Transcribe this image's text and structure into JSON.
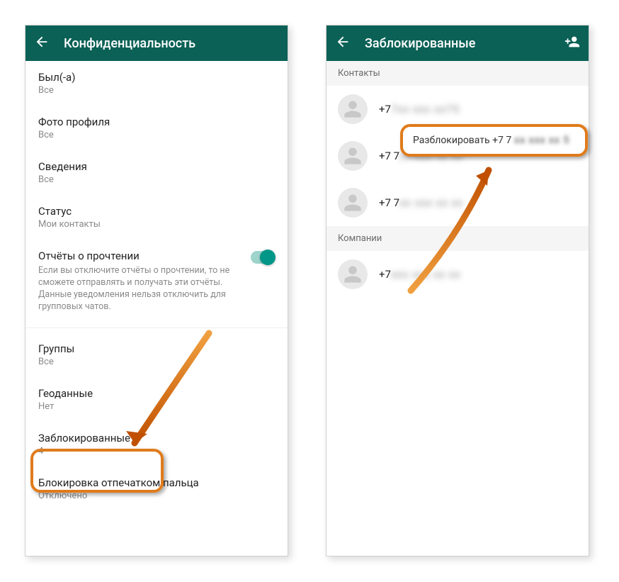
{
  "left": {
    "title": "Конфиденциальность",
    "items": {
      "lastseen": {
        "label": "Был(-а)",
        "sub": "Все"
      },
      "photo": {
        "label": "Фото профиля",
        "sub": "Все"
      },
      "about": {
        "label": "Сведения",
        "sub": "Все"
      },
      "status": {
        "label": "Статус",
        "sub": "Мои контакты"
      },
      "readreceipts": {
        "label": "Отчёты о прочтении",
        "desc": "Если вы отключите отчёты о прочтении, то не сможете отправлять и получать эти отчёты. Данные уведомления нельзя отключить для групповых чатов."
      },
      "groups": {
        "label": "Группы",
        "sub": "Все"
      },
      "location": {
        "label": "Геоданные",
        "sub": "Нет"
      },
      "blocked": {
        "label": "Заблокированные",
        "sub": "4"
      },
      "fingerprint": {
        "label": "Блокировка отпечатком пальца",
        "sub": "Отключено"
      }
    }
  },
  "right": {
    "title": "Заблокированные",
    "section_contacts": "Контакты",
    "section_companies": "Компании",
    "contacts": [
      {
        "display": "+7",
        "masked": "7xx xxx xx75"
      },
      {
        "display": "+7 7",
        "masked": "xx xxx xx xx"
      },
      {
        "display": "+7 7",
        "masked": "xx xxx xx xx"
      }
    ],
    "companies": [
      {
        "display": "+7",
        "masked": "xxx xxx xx xx"
      }
    ],
    "popup": {
      "action": "Разблокировать +7 7",
      "masked": "xx xxx xx 5"
    }
  }
}
